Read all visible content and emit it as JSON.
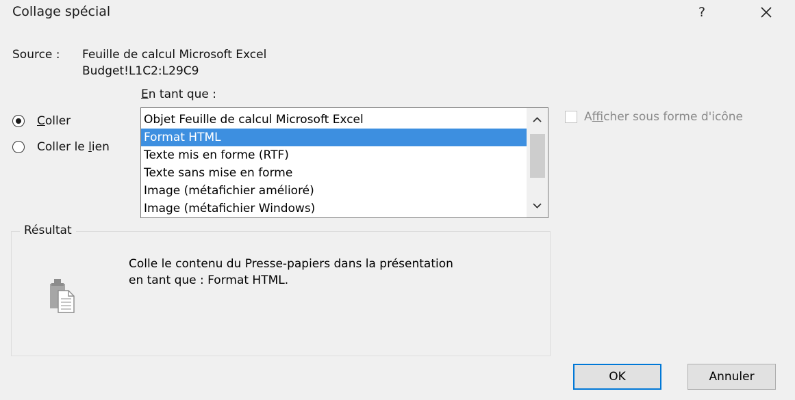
{
  "dialog": {
    "title": "Collage spécial",
    "help_label": "?",
    "close_icon": "close-icon"
  },
  "source": {
    "label": "Source :",
    "line1": "Feuille de calcul Microsoft Excel",
    "line2": "Budget!L1C2:L29C9"
  },
  "as_label": "En tant que :",
  "paste_options": {
    "paste_label": "Coller",
    "paste_link_label": "Coller le lien",
    "selected": "Coller"
  },
  "formats": {
    "items": [
      "Objet Feuille de calcul Microsoft Excel",
      "Format HTML",
      "Texte mis en forme (RTF)",
      "Texte sans mise en forme",
      "Image (métafichier amélioré)",
      "Image (métafichier Windows)"
    ],
    "selected": "Format HTML"
  },
  "display_as_icon": {
    "label": "Afficher sous forme d'icône",
    "checked": false,
    "enabled": false
  },
  "result": {
    "legend": "Résultat",
    "line1": "Colle le contenu du Presse-papiers dans la présentation",
    "line2": "en tant que : Format HTML.",
    "icon": "clipboard-paste-icon"
  },
  "buttons": {
    "ok": "OK",
    "cancel": "Annuler"
  },
  "colors": {
    "selection": "#3d8fe0",
    "default_button_border": "#0078d7",
    "dialog_background": "#f0f0f0"
  }
}
